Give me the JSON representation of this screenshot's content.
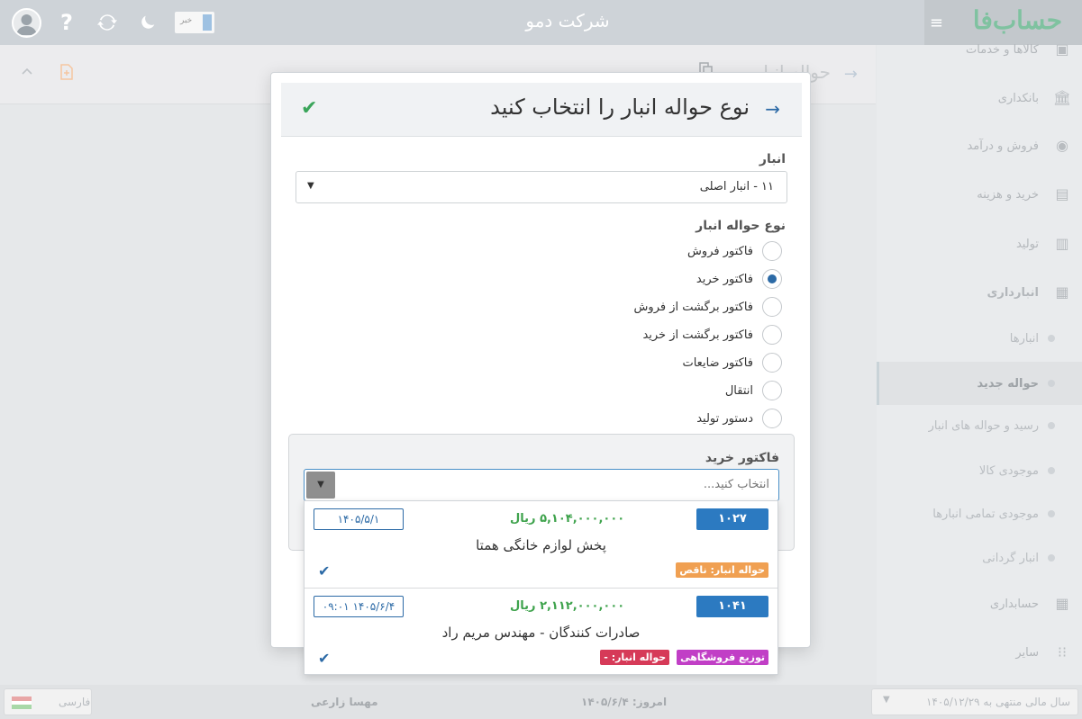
{
  "topbar": {
    "company_name": "شرکت دمو",
    "logo_text": "حساب‌فا",
    "notification_text": "خبر"
  },
  "sidebar": {
    "items": [
      {
        "label": "کالاها و خدمات",
        "icon": "box-icon"
      },
      {
        "label": "بانکداری",
        "icon": "bank-icon"
      },
      {
        "label": "فروش و درآمد",
        "icon": "sales-icon"
      },
      {
        "label": "خرید و هزینه",
        "icon": "wallet-icon"
      },
      {
        "label": "تولید",
        "icon": "factory-icon"
      },
      {
        "label": "انبارداری",
        "icon": "warehouse-icon"
      }
    ],
    "sub_items": [
      {
        "label": "انبارها"
      },
      {
        "label": "حواله جدید"
      },
      {
        "label": "رسید و حواله های انبار"
      },
      {
        "label": "موجودی کالا"
      },
      {
        "label": "موجودی تمامی انبارها"
      },
      {
        "label": "انبار گردانی"
      }
    ],
    "bottom_items": [
      {
        "label": "حسابداری",
        "icon": "ledger-icon"
      },
      {
        "label": "سایر",
        "icon": "grid-icon"
      }
    ]
  },
  "background_page": {
    "title": "حواله انبار"
  },
  "modal": {
    "title": "نوع حواله انبار را انتخاب کنید",
    "warehouse_label": "انبار",
    "warehouse_value": "۱۱ - انبار اصلی",
    "type_label": "نوع حواله انبار",
    "types": [
      {
        "label": "فاکتور فروش",
        "checked": false
      },
      {
        "label": "فاکتور خرید",
        "checked": true
      },
      {
        "label": "فاکتور برگشت از فروش",
        "checked": false
      },
      {
        "label": "فاکتور برگشت از خرید",
        "checked": false
      },
      {
        "label": "فاکتور ضایعات",
        "checked": false
      },
      {
        "label": "انتقال",
        "checked": false
      },
      {
        "label": "دستور تولید",
        "checked": false
      }
    ],
    "invoice_label": "فاکتور خرید",
    "invoice_placeholder": "انتخاب کنید..."
  },
  "dropdown": {
    "items": [
      {
        "number": "۱۰۲۷",
        "amount": "۵,۱۰۴,۰۰۰,۰۰۰ ریال",
        "date": "۱۴۰۵/۵/۱",
        "name": "پخش لوازم خانگی همتا",
        "badges": [
          {
            "text": "حواله انبار: ناقص",
            "color": "#f0a052"
          }
        ]
      },
      {
        "number": "۱۰۴۱",
        "amount": "۲,۱۱۲,۰۰۰,۰۰۰ ریال",
        "date": "۱۴۰۵/۶/۴  ۰۹:۰۱",
        "name": "صادرات کنندگان - مهندس مریم راد",
        "badges": [
          {
            "text": "توزیع فروشگاهی",
            "color": "#c13fc6"
          },
          {
            "text": "حواله انبار: -",
            "color": "#d63a58"
          }
        ]
      }
    ]
  },
  "bottombar": {
    "language": "فارسی",
    "user_name": "مهسا زارعی",
    "today": "امروز: ۱۴۰۵/۶/۴",
    "fiscal_year": "سال مالی منتهی به ۱۴۰۵/۱۲/۲۹"
  }
}
